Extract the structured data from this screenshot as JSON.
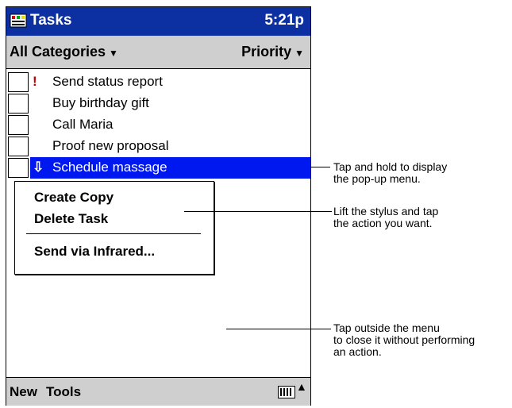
{
  "app": {
    "title": "Tasks",
    "clock": "5:21p"
  },
  "filters": {
    "category": "All Categories",
    "sort": "Priority"
  },
  "tasks": [
    {
      "mark": "!",
      "label": "Send status report"
    },
    {
      "mark": "",
      "label": "Buy birthday gift"
    },
    {
      "mark": "",
      "label": "Call Maria"
    },
    {
      "mark": "",
      "label": "Proof new proposal"
    },
    {
      "mark": "⇩",
      "label": "Schedule massage"
    }
  ],
  "popup": {
    "create_copy": "Create Copy",
    "delete_task": "Delete Task",
    "send_infrared": "Send via Infrared..."
  },
  "bottom": {
    "new": "New",
    "tools": "Tools"
  },
  "callouts": {
    "tap_hold_1": "Tap and hold to display",
    "tap_hold_2": "the pop-up menu.",
    "lift_1": "Lift the stylus and tap",
    "lift_2": "the action you want.",
    "outside_1": "Tap outside the menu",
    "outside_2": "to close it without performing",
    "outside_3": "an action."
  },
  "colors": {
    "titlebar": "#0c2fa2",
    "selection": "#0018f0",
    "bars": "#cfcfcf"
  }
}
